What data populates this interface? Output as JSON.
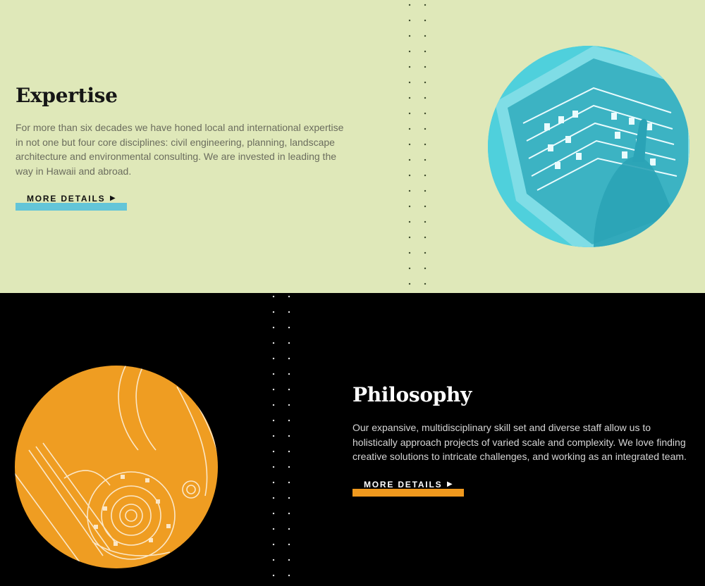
{
  "expertise": {
    "title": "Expertise",
    "body": "For more than six decades we have honed local and international expertise in not one but four core disciplines: civil engineering, planning, landscape architecture and environmental consulting. We are invested in leading the way in Hawaii and abroad.",
    "button_label": "MORE DETAILS",
    "arrow_icon": "play-arrow-icon",
    "image": "tablet-architectural-drawing-photo",
    "colors": {
      "background": "#dfe8b9",
      "accent": "#63c5d8",
      "image_tint": "#4fd0dc"
    }
  },
  "philosophy": {
    "title": "Philosophy",
    "body": "Our expansive, multidisciplinary skill set and diverse staff allow us to holistically approach projects of varied scale and complexity. We love finding creative solutions to intricate challenges, and working as an integrated team.",
    "button_label": "MORE DETAILS",
    "arrow_icon": "play-arrow-icon",
    "image": "site-plan-drawing",
    "colors": {
      "background": "#000000",
      "accent": "#f0991e",
      "image_tint": "#ef9d22"
    }
  }
}
